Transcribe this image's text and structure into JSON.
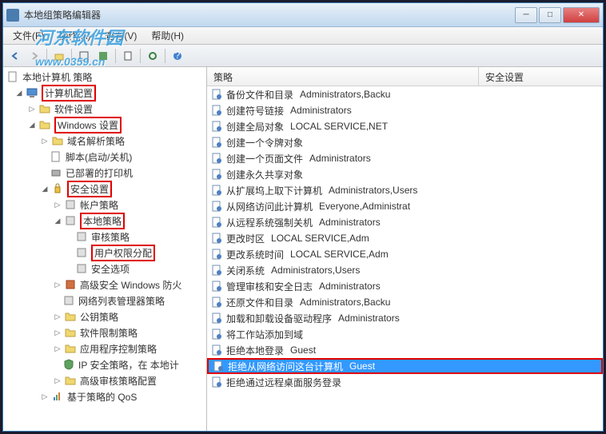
{
  "window": {
    "title": "本地组策略编辑器"
  },
  "watermark": "河东软件园\nwww.0359.cn",
  "menu": {
    "file": "文件(F)",
    "action": "操作(A)",
    "view": "查看(V)",
    "help": "帮助(H)"
  },
  "tree": {
    "root": "本地计算机 策略",
    "computer_config": "计算机配置",
    "software_settings": "软件设置",
    "windows_settings": "Windows 设置",
    "dns_policy": "域名解析策略",
    "scripts": "脚本(启动/关机)",
    "deployed_printers": "已部署的打印机",
    "security_settings": "安全设置",
    "account_policy": "帐户策略",
    "local_policy": "本地策略",
    "audit_policy": "审核策略",
    "user_rights": "用户权限分配",
    "security_options": "安全选项",
    "advanced_security": "高级安全 Windows 防火",
    "network_list": "网络列表管理器策略",
    "public_key": "公钥策略",
    "software_restriction": "软件限制策略",
    "app_control": "应用程序控制策略",
    "ip_security": "IP 安全策略，在 本地计",
    "advanced_audit": "高级审核策略配置",
    "policy_qos": "基于策略的 QoS"
  },
  "list": {
    "col_policy": "策略",
    "col_security": "安全设置",
    "rows": [
      {
        "policy": "备份文件和目录",
        "setting": "Administrators,Backu"
      },
      {
        "policy": "创建符号链接",
        "setting": "Administrators"
      },
      {
        "policy": "创建全局对象",
        "setting": "LOCAL SERVICE,NET"
      },
      {
        "policy": "创建一个令牌对象",
        "setting": ""
      },
      {
        "policy": "创建一个页面文件",
        "setting": "Administrators"
      },
      {
        "policy": "创建永久共享对象",
        "setting": ""
      },
      {
        "policy": "从扩展坞上取下计算机",
        "setting": "Administrators,Users"
      },
      {
        "policy": "从网络访问此计算机",
        "setting": "Everyone,Administrat"
      },
      {
        "policy": "从远程系统强制关机",
        "setting": "Administrators"
      },
      {
        "policy": "更改时区",
        "setting": "LOCAL SERVICE,Adm"
      },
      {
        "policy": "更改系统时间",
        "setting": "LOCAL SERVICE,Adm"
      },
      {
        "policy": "关闭系统",
        "setting": "Administrators,Users"
      },
      {
        "policy": "管理审核和安全日志",
        "setting": "Administrators"
      },
      {
        "policy": "还原文件和目录",
        "setting": "Administrators,Backu"
      },
      {
        "policy": "加载和卸载设备驱动程序",
        "setting": "Administrators"
      },
      {
        "policy": "将工作站添加到域",
        "setting": ""
      },
      {
        "policy": "拒绝本地登录",
        "setting": "Guest"
      },
      {
        "policy": "拒绝从网络访问这台计算机",
        "setting": "Guest"
      },
      {
        "policy": "拒绝通过远程桌面服务登录",
        "setting": ""
      }
    ]
  }
}
